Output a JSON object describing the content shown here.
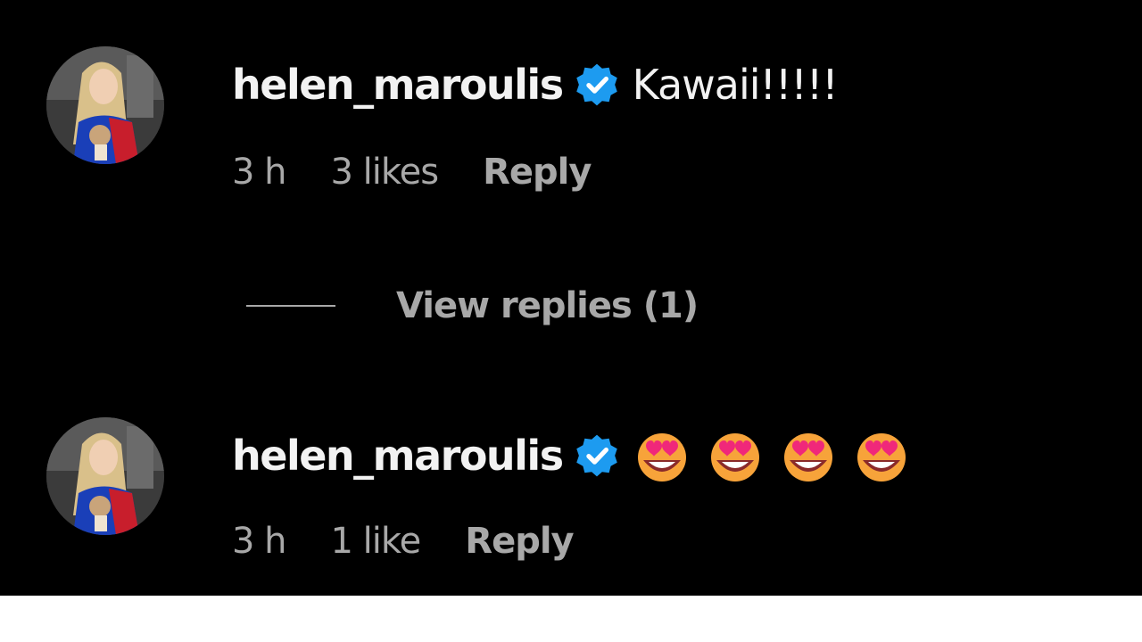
{
  "comments": [
    {
      "username": "helen_maroulis",
      "verified": true,
      "text": "Kawaii!!!!!",
      "time": "3 h",
      "likes": "3 likes",
      "reply_label": "Reply",
      "view_replies_label": "View replies (1)"
    },
    {
      "username": "helen_maroulis",
      "verified": true,
      "emojis": [
        "smiling-face-with-heart-eyes",
        "smiling-face-with-heart-eyes",
        "smiling-face-with-heart-eyes",
        "smiling-face-with-heart-eyes"
      ],
      "time": "3 h",
      "likes": "1 like",
      "reply_label": "Reply"
    }
  ],
  "colors": {
    "background": "#000000",
    "primary_text": "#f2f2f2",
    "secondary_text": "#a8a8a8",
    "verified_badge": "#1d9bf0"
  },
  "icons": {
    "verified": "verified-badge-icon",
    "avatar": "profile-avatar"
  }
}
